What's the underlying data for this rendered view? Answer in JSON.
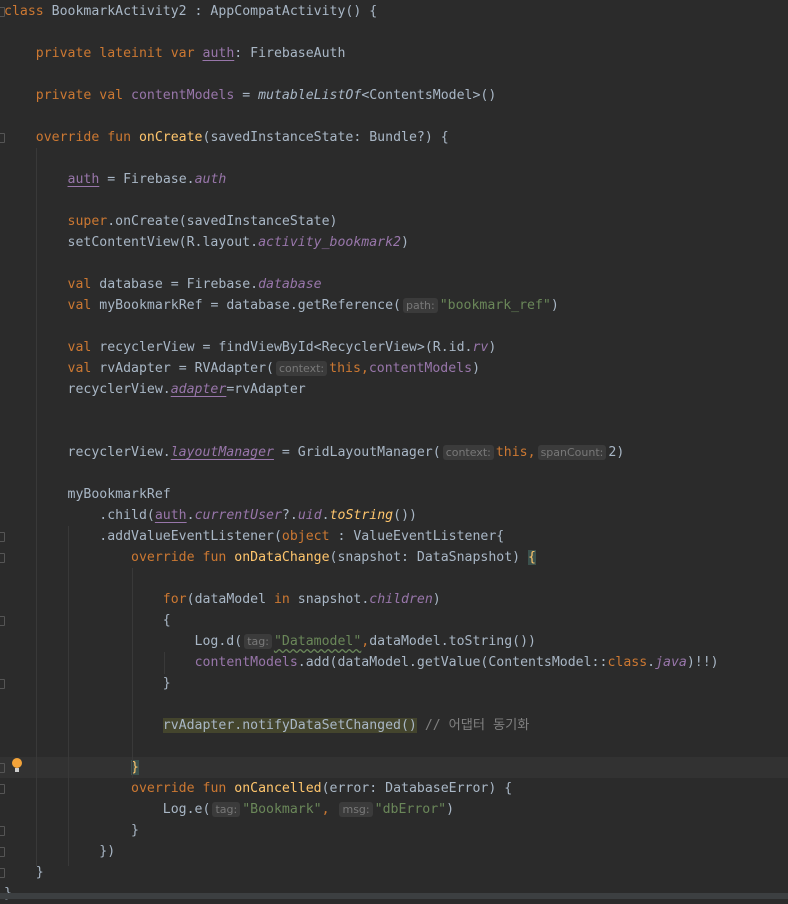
{
  "code_lines": [
    [
      [
        "k",
        "class "
      ],
      [
        "t",
        "BookmarkActivity2 : AppCompatActivity() {"
      ]
    ],
    [],
    [
      [
        "t",
        "    "
      ],
      [
        "k",
        "private lateinit var "
      ],
      [
        "pu",
        "auth"
      ],
      [
        "t",
        ": FirebaseAuth"
      ]
    ],
    [],
    [
      [
        "t",
        "    "
      ],
      [
        "k",
        "private val "
      ],
      [
        "p",
        "contentModels"
      ],
      [
        "t",
        " = "
      ],
      [
        "i",
        "mutableListOf"
      ],
      [
        "t",
        "<ContentsModel>()"
      ]
    ],
    [],
    [
      [
        "t",
        "    "
      ],
      [
        "k",
        "override fun "
      ],
      [
        "f",
        "onCreate"
      ],
      [
        "t",
        "(savedInstanceState: Bundle?) {"
      ]
    ],
    [],
    [
      [
        "t",
        "        "
      ],
      [
        "pu",
        "auth"
      ],
      [
        "t",
        " = Firebase."
      ],
      [
        "pi",
        "auth"
      ]
    ],
    [],
    [
      [
        "t",
        "        "
      ],
      [
        "k",
        "super"
      ],
      [
        "t",
        ".onCreate(savedInstanceState)"
      ]
    ],
    [
      [
        "t",
        "        setContentView(R.layout."
      ],
      [
        "pi",
        "activity_bookmark2"
      ],
      [
        "t",
        ")"
      ]
    ],
    [],
    [
      [
        "t",
        "        "
      ],
      [
        "k",
        "val "
      ],
      [
        "t",
        "database = Firebase."
      ],
      [
        "pi",
        "database"
      ]
    ],
    [
      [
        "t",
        "        "
      ],
      [
        "k",
        "val "
      ],
      [
        "t",
        "myBookmarkRef = database.getReference("
      ],
      [
        "h",
        "path:"
      ],
      [
        "s",
        "\"bookmark_ref\""
      ],
      [
        "t",
        ")"
      ]
    ],
    [],
    [
      [
        "t",
        "        "
      ],
      [
        "k",
        "val "
      ],
      [
        "t",
        "recyclerView = findViewById<RecyclerView>(R.id."
      ],
      [
        "pi",
        "rv"
      ],
      [
        "t",
        ")"
      ]
    ],
    [
      [
        "t",
        "        "
      ],
      [
        "k",
        "val "
      ],
      [
        "t",
        "rvAdapter = RVAdapter("
      ],
      [
        "h",
        "context:"
      ],
      [
        "k",
        "this,"
      ],
      [
        "p",
        "contentModels"
      ],
      [
        "t",
        ")"
      ]
    ],
    [
      [
        "t",
        "        recyclerView."
      ],
      [
        "piu",
        "adapter"
      ],
      [
        "t",
        "=rvAdapter"
      ]
    ],
    [],
    [],
    [
      [
        "t",
        "        recyclerView."
      ],
      [
        "piu",
        "layoutManager"
      ],
      [
        "t",
        " = GridLayoutManager("
      ],
      [
        "h",
        "context:"
      ],
      [
        "k",
        "this,"
      ],
      [
        "h",
        "spanCount:"
      ],
      [
        "t",
        "2)"
      ]
    ],
    [],
    [
      [
        "t",
        "        myBookmarkRef"
      ]
    ],
    [
      [
        "t",
        "            .child("
      ],
      [
        "pu",
        "auth"
      ],
      [
        "t",
        "."
      ],
      [
        "pi",
        "currentUser"
      ],
      [
        "t",
        "?."
      ],
      [
        "pi",
        "uid"
      ],
      [
        "t",
        "."
      ],
      [
        "y",
        "toString"
      ],
      [
        "t",
        "())"
      ]
    ],
    [
      [
        "t",
        "            .addValueEventListener("
      ],
      [
        "k",
        "object"
      ],
      [
        "t",
        " : ValueEventListener{"
      ]
    ],
    [
      [
        "t",
        "                "
      ],
      [
        "k",
        "override fun "
      ],
      [
        "f",
        "onDataChange"
      ],
      [
        "t",
        "(snapshot: DataSnapshot) "
      ],
      [
        "br",
        "{"
      ]
    ],
    [],
    [
      [
        "t",
        "                    "
      ],
      [
        "k",
        "for"
      ],
      [
        "t",
        "(dataModel "
      ],
      [
        "k",
        "in"
      ],
      [
        "t",
        " snapshot."
      ],
      [
        "pi",
        "children"
      ],
      [
        "t",
        ")"
      ]
    ],
    [
      [
        "t",
        "                    {"
      ]
    ],
    [
      [
        "t",
        "                        Log.d("
      ],
      [
        "h",
        "tag:"
      ],
      [
        "sw",
        "\"Datamodel\""
      ],
      [
        "k",
        ","
      ],
      [
        "t",
        "dataModel.toString())"
      ]
    ],
    [
      [
        "t",
        "                        "
      ],
      [
        "p",
        "contentModels"
      ],
      [
        "t",
        ".add(dataModel.getValue(ContentsModel::"
      ],
      [
        "k",
        "class"
      ],
      [
        "t",
        "."
      ],
      [
        "pi",
        "java"
      ],
      [
        "t",
        ")!!)"
      ]
    ],
    [
      [
        "t",
        "                    }"
      ]
    ],
    [],
    [
      [
        "t",
        "                    "
      ],
      [
        "hl",
        "rvAdapter.notifyDataSetChanged()"
      ],
      [
        "c",
        " // 어댑터 동기화"
      ]
    ],
    [],
    [
      [
        "t",
        "                "
      ],
      [
        "br",
        "}"
      ]
    ],
    [
      [
        "t",
        "                "
      ],
      [
        "k",
        "override fun "
      ],
      [
        "f",
        "onCancelled"
      ],
      [
        "t",
        "(error: DatabaseError) {"
      ]
    ],
    [
      [
        "t",
        "                    Log.e("
      ],
      [
        "h",
        "tag:"
      ],
      [
        "s",
        "\"Bookmark\""
      ],
      [
        "k",
        ", "
      ],
      [
        "h",
        "msg:"
      ],
      [
        "s",
        "\"dbError\""
      ],
      [
        "t",
        ")"
      ]
    ],
    [
      [
        "t",
        "                }"
      ]
    ],
    [
      [
        "t",
        "            })"
      ]
    ],
    [
      [
        "t",
        "    }"
      ]
    ],
    [
      [
        "t",
        "}"
      ]
    ]
  ],
  "current_line": 36,
  "colors": {
    "background": "#2b2b2b",
    "keyword": "#cc7832",
    "text": "#a9b7c6",
    "function": "#ffc66d",
    "property": "#9876aa",
    "string": "#6a8759",
    "comment": "#808080"
  }
}
